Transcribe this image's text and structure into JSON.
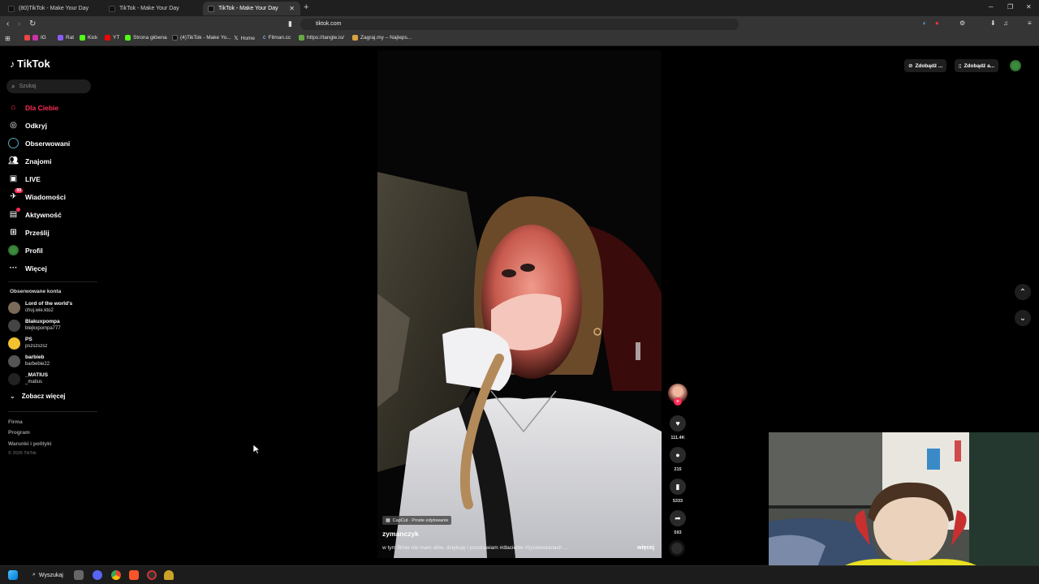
{
  "browser": {
    "tabs": [
      {
        "title": "(80)TikTok - Make Your Day"
      },
      {
        "title": "TikTok - Make Your Day"
      },
      {
        "title": "TikTok - Make Your Day"
      }
    ],
    "url": "tiktok.com",
    "bookmarks": [
      "IG",
      "Rat",
      "Kick",
      "YT",
      "Strona główna",
      "(4)TikTok - Make Yo...",
      "Home",
      "Filman.cc",
      "https://tangle.io/",
      "Zagraj.my – Najleps..."
    ]
  },
  "sidebar": {
    "logo": "TikTok",
    "search_placeholder": "Szukaj",
    "nav": [
      {
        "label": "Dla Ciebie",
        "icon": "home-icon"
      },
      {
        "label": "Odkryj",
        "icon": "compass-icon"
      },
      {
        "label": "Obserwowani",
        "icon": "following-icon"
      },
      {
        "label": "Znajomi",
        "icon": "friends-icon"
      },
      {
        "label": "LIVE",
        "icon": "live-icon"
      },
      {
        "label": "Wiadomości",
        "icon": "messages-icon",
        "badge": "99"
      },
      {
        "label": "Aktywność",
        "icon": "activity-icon"
      },
      {
        "label": "Prześlij",
        "icon": "upload-icon"
      },
      {
        "label": "Profil",
        "icon": "profile-icon"
      },
      {
        "label": "Więcej",
        "icon": "more-icon"
      }
    ],
    "followed_title": "Obserwowane konta",
    "followed": [
      {
        "name": "Lord of the world's",
        "handle": "chuj.wie.kto2"
      },
      {
        "name": "Blakuxpompa",
        "handle": "blejkxpompa777"
      },
      {
        "name": "PS",
        "handle": "pszszszsz"
      },
      {
        "name": "barbieb",
        "handle": "barbebie22"
      },
      {
        "name": "_MATIUS",
        "handle": "_matius"
      }
    ],
    "see_more": "Zobacz więcej",
    "footer": [
      "Firma",
      "Program",
      "Warunki i polityki"
    ],
    "copyright": "© 2026 TikTok"
  },
  "topbar": {
    "btn1": "Zdobądź ...",
    "btn2": "Zdobądź a..."
  },
  "video": {
    "capcut": "CapCut · Proste edytowanie",
    "author": "zymanczyk",
    "caption": "w tym filmie nie mam słów, dziękuję i pozdrawiam #dlaciebie #życiewstanach ...",
    "more": "więcej",
    "likes": "111.4K",
    "comments": "215",
    "saves": "5333",
    "shares": "593"
  },
  "taskbar": {
    "search": "Wyszukaj"
  },
  "colors": {
    "accent": "#fe2c55",
    "background": "#000000"
  }
}
